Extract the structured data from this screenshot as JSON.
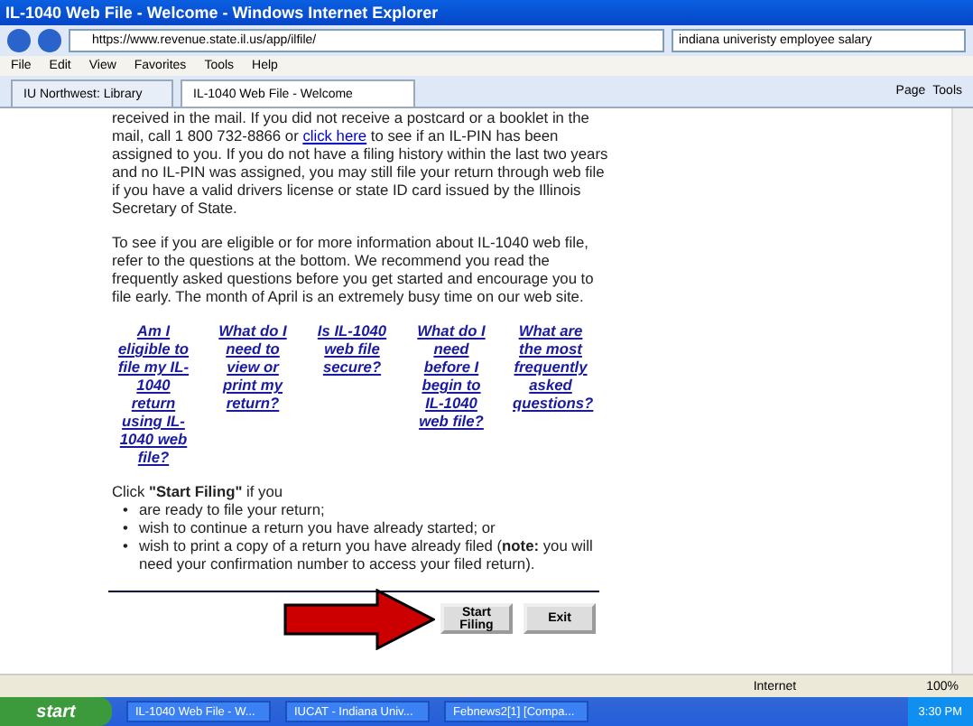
{
  "window": {
    "title": "IL-1040 Web File - Welcome - Windows Internet Explorer"
  },
  "address": {
    "url": "https://www.revenue.state.il.us/app/ilfile/"
  },
  "search": {
    "value": "indiana univeristy employee salary"
  },
  "menu": [
    "File",
    "Edit",
    "View",
    "Favorites",
    "Tools",
    "Help"
  ],
  "tabs": [
    {
      "label": "IU Northwest: Library",
      "selected": false
    },
    {
      "label": "IL-1040 Web File - Welcome",
      "selected": true
    }
  ],
  "command_bar": [
    "Page",
    "Tools"
  ],
  "content": {
    "paragraph_1": {
      "before": "received in the mail. If you did not receive a postcard or a booklet in the mail, call 1 800 732-8866 or",
      "link": "click here",
      "after": "to see if an IL-PIN has been assigned to you. If you do not have a filing history within the last two years and no IL-PIN was assigned, you may still file your return through web file if you have a valid drivers license or state ID card issued by the Illinois Secretary of State."
    },
    "paragraph_2": "To see if you are eligible or for more information about IL-1040 web file, refer to the questions at the bottom. We recommend you read the frequently asked questions before you get started and encourage you to file early. The month of April is an extremely busy time on our web site.",
    "questions": [
      "Am I eligible to file my IL-1040 return using IL-1040 web file?",
      "What do I need to view or print my return?",
      "Is IL-1040 web file secure?",
      "What do I need before I begin to IL-1040 web file?",
      "What are the most frequently asked questions?"
    ],
    "instruction": "Click **\"Start Filing\"** if you",
    "bullets": [
      {
        "marker": "•",
        "text": "are ready to file your return;"
      },
      {
        "marker": "•",
        "text": "wish to continue a return you have already started; or"
      },
      {
        "marker": "•",
        "text": "wish to print a copy of a return you have already filed (**note:** you will need your confirmation number to access your filed return)."
      }
    ],
    "buttons": [
      "Start Filing",
      "Exit"
    ]
  },
  "status_bar": {
    "zone": "Internet",
    "zoom": "100%"
  },
  "taskbar": {
    "start": "start",
    "items": [
      "IL-1040 Web File - W...",
      "IUCAT - Indiana Univ...",
      "Febnews2[1] [Compa..."
    ],
    "clock": "3:30 PM"
  }
}
